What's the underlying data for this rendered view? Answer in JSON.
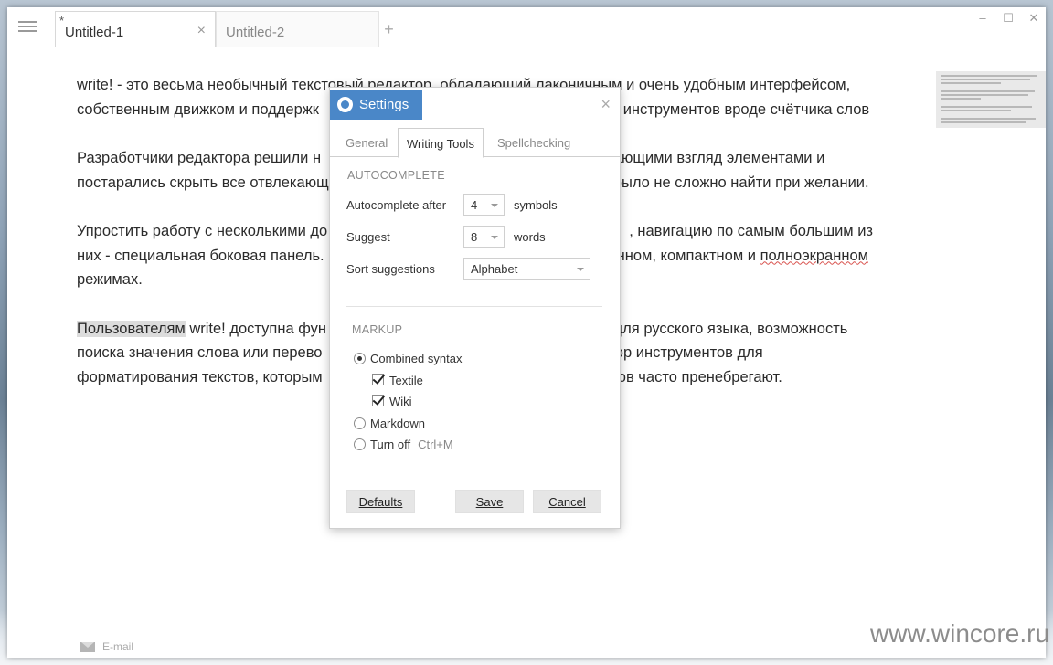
{
  "tabs": [
    {
      "label": "Untitled-1",
      "modified_mark": "*",
      "close": "×"
    },
    {
      "label": "Untitled-2"
    }
  ],
  "tab_add": "+",
  "window_controls": [
    "–",
    "☐",
    "✕"
  ],
  "document": {
    "p1": "write! - это весьма необычный текстовый редактор, обладающий лаконичным и очень удобным интерфейсом, собственным движком и поддержк",
    "p1b": " полезных дополнительных инструментов вроде счётчика слов",
    "p2a": "Разработчики редактора решили н",
    "p2b": "влекающими взгляд элементами и постарались скрыть все отвлекающ",
    "p2c": "и их было не сложно найти при желании.",
    "p3a": "Упростить работу с несколькими до",
    "p3b": ", навигацию по самым большим из них - специальная боковая панель.",
    "p3c": "нном, компактном и ",
    "p3_spell": "полноэкранном",
    "p3d": " режимах.",
    "p4_hl": "Пользователям",
    "p4a": " write! доступна фун",
    "p4b": " для русского языка, возможность поиска значения слова или перево",
    "p4c": " набор инструментов для форматирования текстов, которым",
    "p4d": "кторов часто пренебрегают."
  },
  "footer": {
    "email_label": "E-mail"
  },
  "watermark": "www.wincore.ru",
  "settings": {
    "title": "Settings",
    "close": "×",
    "tabs": [
      "General",
      "Writing Tools",
      "Spellchecking"
    ],
    "active_tab": "Writing Tools",
    "autocomplete": {
      "section": "AUTOCOMPLETE",
      "after_label": "Autocomplete after",
      "after_value": "4",
      "after_unit": "symbols",
      "suggest_label": "Suggest",
      "suggest_value": "8",
      "suggest_unit": "words",
      "sort_label": "Sort suggestions",
      "sort_value": "Alphabet"
    },
    "markup": {
      "section": "MARKUP",
      "combined": "Combined syntax",
      "textile": "Textile",
      "wiki": "Wiki",
      "markdown": "Markdown",
      "turn_off": "Turn off",
      "turn_off_shortcut": "Ctrl+M"
    },
    "buttons": {
      "defaults": "Defaults",
      "save": "Save",
      "cancel": "Cancel"
    }
  }
}
